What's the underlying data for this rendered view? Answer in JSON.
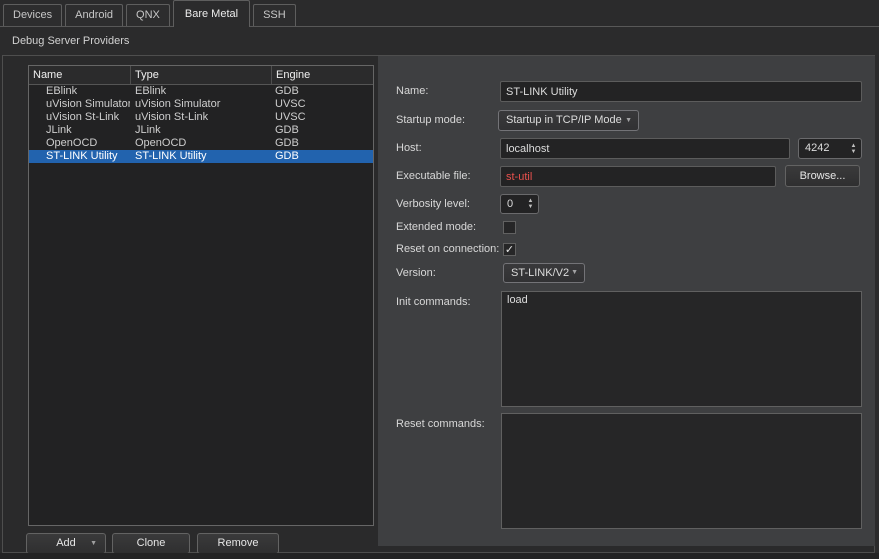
{
  "tabbar": {
    "tabs": [
      {
        "label": "Devices",
        "active": false
      },
      {
        "label": "Android",
        "active": false
      },
      {
        "label": "QNX",
        "active": false
      },
      {
        "label": "Bare Metal",
        "active": true
      },
      {
        "label": "SSH",
        "active": false
      }
    ]
  },
  "page": {
    "title": "Debug Server Providers"
  },
  "providers_table": {
    "columns": [
      {
        "label": "Name"
      },
      {
        "label": "Type"
      },
      {
        "label": "Engine"
      }
    ],
    "rows": [
      {
        "name": "EBlink",
        "type": "EBlink",
        "engine": "GDB",
        "selected": false
      },
      {
        "name": "uVision Simulator",
        "type": "uVision Simulator",
        "engine": "UVSC",
        "selected": false
      },
      {
        "name": "uVision St-Link",
        "type": "uVision St-Link",
        "engine": "UVSC",
        "selected": false
      },
      {
        "name": "JLink",
        "type": "JLink",
        "engine": "GDB",
        "selected": false
      },
      {
        "name": "OpenOCD",
        "type": "OpenOCD",
        "engine": "GDB",
        "selected": false
      },
      {
        "name": "ST-LINK Utility",
        "type": "ST-LINK Utility",
        "engine": "GDB",
        "selected": true
      }
    ]
  },
  "actions": {
    "add_label": "Add",
    "clone_label": "Clone",
    "remove_label": "Remove"
  },
  "form": {
    "name": {
      "label": "Name:",
      "value": "ST-LINK Utility"
    },
    "startup_mode": {
      "label": "Startup mode:",
      "value": "Startup in TCP/IP Mode"
    },
    "host": {
      "label": "Host:",
      "value": "localhost",
      "port": "4242"
    },
    "executable": {
      "label": "Executable file:",
      "value": "st-util",
      "browse_label": "Browse...",
      "value_color": "#e8514d"
    },
    "verbosity": {
      "label": "Verbosity level:",
      "value": "0"
    },
    "extended_mode": {
      "label": "Extended mode:",
      "checked": false,
      "glyph": ""
    },
    "reset_on_connection": {
      "label": "Reset on connection:",
      "checked": true,
      "glyph": "✓"
    },
    "version": {
      "label": "Version:",
      "value": "ST-LINK/V2"
    },
    "init_commands": {
      "label": "Init commands:",
      "value": "load"
    },
    "reset_commands": {
      "label": "Reset commands:",
      "value": ""
    }
  },
  "icons": {
    "chevron_down": "▼",
    "spin_up": "▲",
    "spin_down": "▼",
    "check": "✓"
  },
  "colors": {
    "selection_bg": "#2263ae",
    "error_text": "#e8514d",
    "panel_bg": "#3e3f41",
    "window_bg": "#2b2b2c"
  }
}
